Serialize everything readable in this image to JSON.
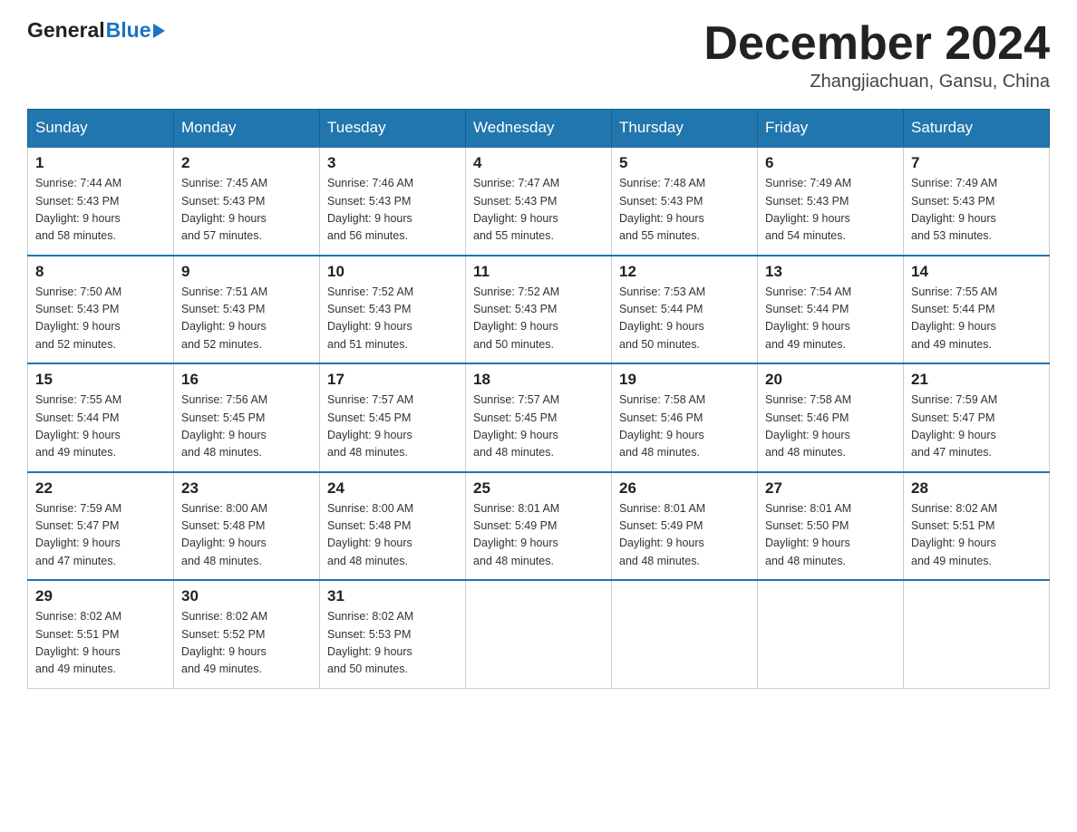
{
  "header": {
    "title": "December 2024",
    "subtitle": "Zhangjiachuan, Gansu, China",
    "logo_general": "General",
    "logo_blue": "Blue"
  },
  "weekdays": [
    "Sunday",
    "Monday",
    "Tuesday",
    "Wednesday",
    "Thursday",
    "Friday",
    "Saturday"
  ],
  "weeks": [
    [
      {
        "day": "1",
        "sunrise": "7:44 AM",
        "sunset": "5:43 PM",
        "daylight": "9 hours and 58 minutes."
      },
      {
        "day": "2",
        "sunrise": "7:45 AM",
        "sunset": "5:43 PM",
        "daylight": "9 hours and 57 minutes."
      },
      {
        "day": "3",
        "sunrise": "7:46 AM",
        "sunset": "5:43 PM",
        "daylight": "9 hours and 56 minutes."
      },
      {
        "day": "4",
        "sunrise": "7:47 AM",
        "sunset": "5:43 PM",
        "daylight": "9 hours and 55 minutes."
      },
      {
        "day": "5",
        "sunrise": "7:48 AM",
        "sunset": "5:43 PM",
        "daylight": "9 hours and 55 minutes."
      },
      {
        "day": "6",
        "sunrise": "7:49 AM",
        "sunset": "5:43 PM",
        "daylight": "9 hours and 54 minutes."
      },
      {
        "day": "7",
        "sunrise": "7:49 AM",
        "sunset": "5:43 PM",
        "daylight": "9 hours and 53 minutes."
      }
    ],
    [
      {
        "day": "8",
        "sunrise": "7:50 AM",
        "sunset": "5:43 PM",
        "daylight": "9 hours and 52 minutes."
      },
      {
        "day": "9",
        "sunrise": "7:51 AM",
        "sunset": "5:43 PM",
        "daylight": "9 hours and 52 minutes."
      },
      {
        "day": "10",
        "sunrise": "7:52 AM",
        "sunset": "5:43 PM",
        "daylight": "9 hours and 51 minutes."
      },
      {
        "day": "11",
        "sunrise": "7:52 AM",
        "sunset": "5:43 PM",
        "daylight": "9 hours and 50 minutes."
      },
      {
        "day": "12",
        "sunrise": "7:53 AM",
        "sunset": "5:44 PM",
        "daylight": "9 hours and 50 minutes."
      },
      {
        "day": "13",
        "sunrise": "7:54 AM",
        "sunset": "5:44 PM",
        "daylight": "9 hours and 49 minutes."
      },
      {
        "day": "14",
        "sunrise": "7:55 AM",
        "sunset": "5:44 PM",
        "daylight": "9 hours and 49 minutes."
      }
    ],
    [
      {
        "day": "15",
        "sunrise": "7:55 AM",
        "sunset": "5:44 PM",
        "daylight": "9 hours and 49 minutes."
      },
      {
        "day": "16",
        "sunrise": "7:56 AM",
        "sunset": "5:45 PM",
        "daylight": "9 hours and 48 minutes."
      },
      {
        "day": "17",
        "sunrise": "7:57 AM",
        "sunset": "5:45 PM",
        "daylight": "9 hours and 48 minutes."
      },
      {
        "day": "18",
        "sunrise": "7:57 AM",
        "sunset": "5:45 PM",
        "daylight": "9 hours and 48 minutes."
      },
      {
        "day": "19",
        "sunrise": "7:58 AM",
        "sunset": "5:46 PM",
        "daylight": "9 hours and 48 minutes."
      },
      {
        "day": "20",
        "sunrise": "7:58 AM",
        "sunset": "5:46 PM",
        "daylight": "9 hours and 48 minutes."
      },
      {
        "day": "21",
        "sunrise": "7:59 AM",
        "sunset": "5:47 PM",
        "daylight": "9 hours and 47 minutes."
      }
    ],
    [
      {
        "day": "22",
        "sunrise": "7:59 AM",
        "sunset": "5:47 PM",
        "daylight": "9 hours and 47 minutes."
      },
      {
        "day": "23",
        "sunrise": "8:00 AM",
        "sunset": "5:48 PM",
        "daylight": "9 hours and 48 minutes."
      },
      {
        "day": "24",
        "sunrise": "8:00 AM",
        "sunset": "5:48 PM",
        "daylight": "9 hours and 48 minutes."
      },
      {
        "day": "25",
        "sunrise": "8:01 AM",
        "sunset": "5:49 PM",
        "daylight": "9 hours and 48 minutes."
      },
      {
        "day": "26",
        "sunrise": "8:01 AM",
        "sunset": "5:49 PM",
        "daylight": "9 hours and 48 minutes."
      },
      {
        "day": "27",
        "sunrise": "8:01 AM",
        "sunset": "5:50 PM",
        "daylight": "9 hours and 48 minutes."
      },
      {
        "day": "28",
        "sunrise": "8:02 AM",
        "sunset": "5:51 PM",
        "daylight": "9 hours and 49 minutes."
      }
    ],
    [
      {
        "day": "29",
        "sunrise": "8:02 AM",
        "sunset": "5:51 PM",
        "daylight": "9 hours and 49 minutes."
      },
      {
        "day": "30",
        "sunrise": "8:02 AM",
        "sunset": "5:52 PM",
        "daylight": "9 hours and 49 minutes."
      },
      {
        "day": "31",
        "sunrise": "8:02 AM",
        "sunset": "5:53 PM",
        "daylight": "9 hours and 50 minutes."
      },
      null,
      null,
      null,
      null
    ]
  ],
  "labels": {
    "sunrise": "Sunrise: ",
    "sunset": "Sunset: ",
    "daylight": "Daylight: "
  }
}
